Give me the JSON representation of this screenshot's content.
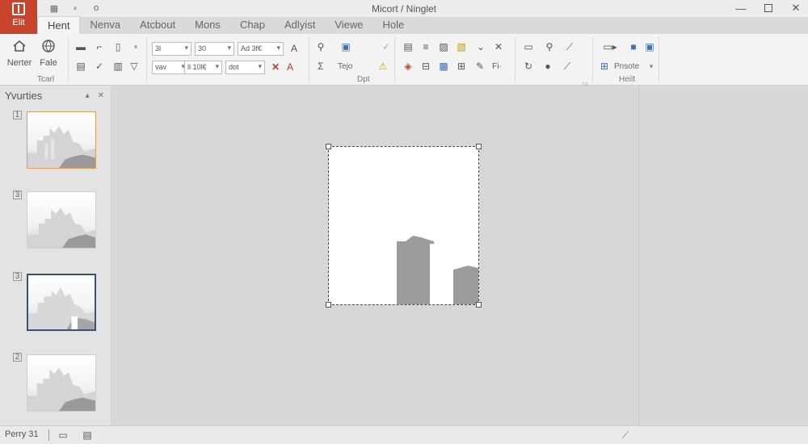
{
  "app": {
    "badge_label": "Elit",
    "title": "Micort / Ninglet"
  },
  "tabs": [
    "Hent",
    "Nenva",
    "Atcbout",
    "Mons",
    "Chap",
    "Adlyist",
    "Viewe",
    "Hole"
  ],
  "ribbon": {
    "group1": {
      "big_buttons": [
        "Nerter",
        "Fale"
      ],
      "label": "Tcarl"
    },
    "font": {
      "combo1": "3l",
      "combo2": "30",
      "combo3": "Ad  3f€",
      "combo4": "vav",
      "combo5": "ll 10l€",
      "combo6": "dot",
      "label": "Dpt"
    },
    "edit": {
      "text1": "Tejo"
    },
    "right": {
      "button_text": "Pnsote",
      "label": "Heilt"
    }
  },
  "pane": {
    "title": "Yvurties",
    "slide_numbers": [
      "1",
      "3",
      "3",
      "2"
    ]
  },
  "status": {
    "page": "Perry 31"
  }
}
